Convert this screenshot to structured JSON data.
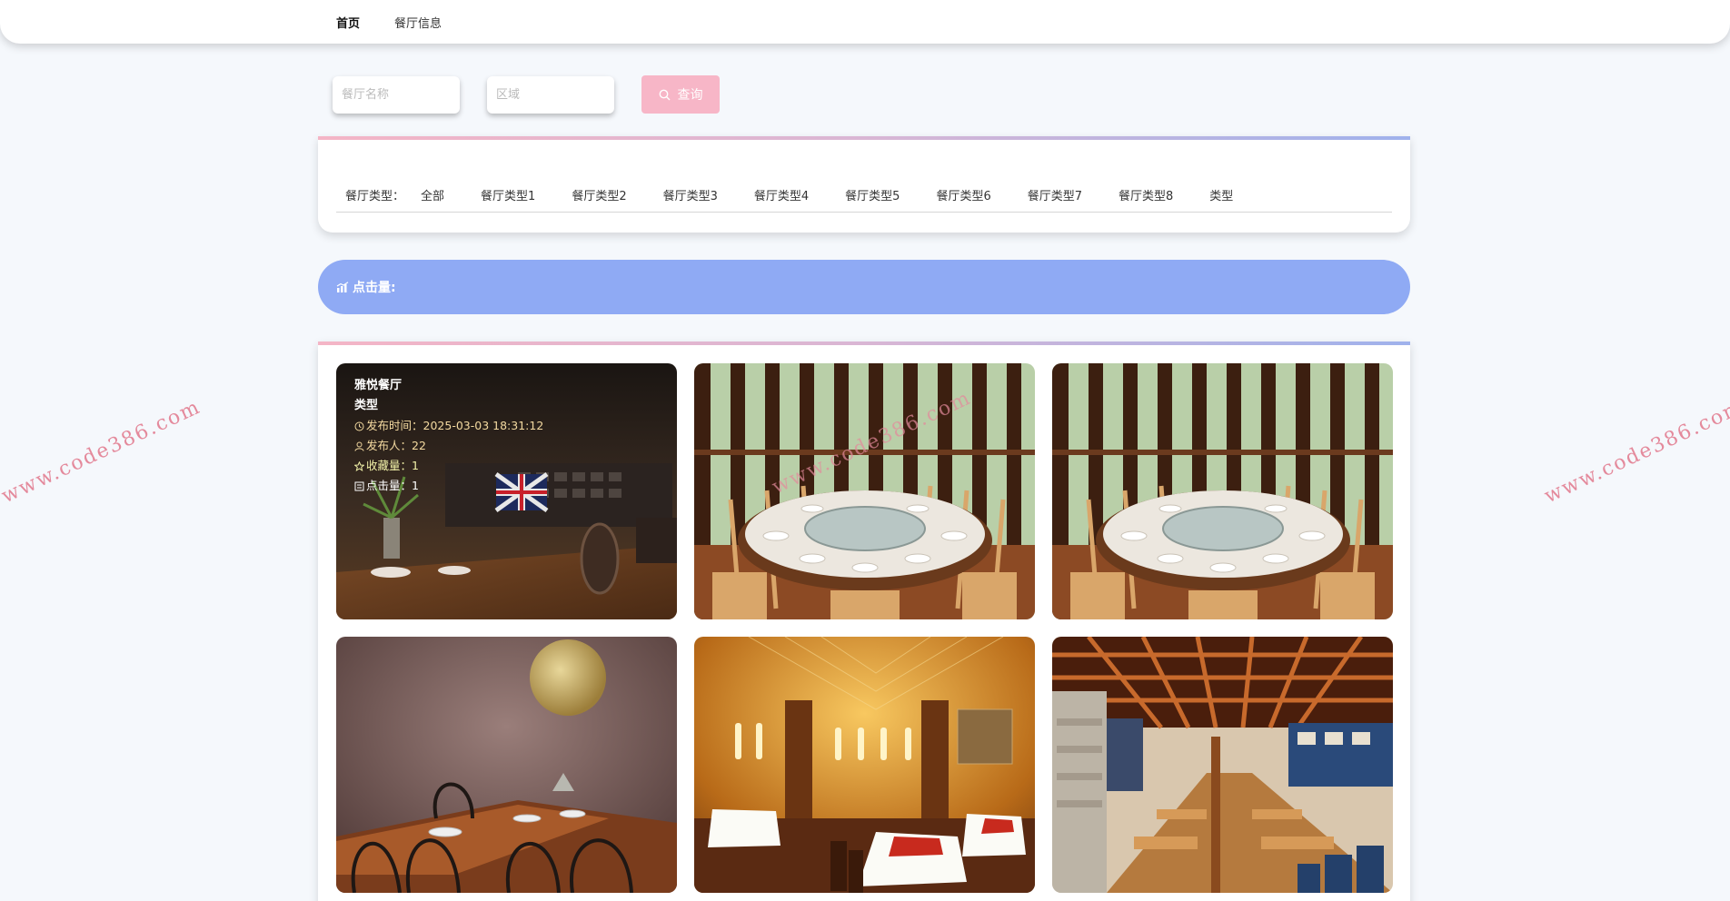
{
  "nav": {
    "items": [
      {
        "label": "首页",
        "active": true
      },
      {
        "label": "餐厅信息",
        "active": false
      }
    ]
  },
  "search": {
    "name_placeholder": "餐厅名称",
    "area_placeholder": "区域",
    "button_label": "查询"
  },
  "types": {
    "label": "餐厅类型：",
    "items": [
      "全部",
      "餐厅类型1",
      "餐厅类型2",
      "餐厅类型3",
      "餐厅类型4",
      "餐厅类型5",
      "餐厅类型6",
      "餐厅类型7",
      "餐厅类型8",
      "类型"
    ]
  },
  "banner": {
    "label": "点击量:"
  },
  "cards": [
    {
      "title": "雅悦餐厅",
      "type": "类型",
      "publish_label": "发布时间：",
      "publish_time": "2025-03-03 18:31:12",
      "author_label": "发布人：",
      "author": "22",
      "fav_label": "收藏量：",
      "fav": "1",
      "clicks_label": "点击量：",
      "clicks": "1",
      "scene": "dark-bistro"
    },
    {
      "scene": "round-table-pavilion"
    },
    {
      "scene": "round-table-pavilion"
    },
    {
      "scene": "moon-wall-dining"
    },
    {
      "scene": "golden-hall"
    },
    {
      "scene": "wooden-ceiling-hall"
    }
  ],
  "watermark": "www.code386.com",
  "colors": {
    "accent_pink": "#f7b6c7",
    "banner_blue": "#8faaf4",
    "meta_gold": "#f3d9a0"
  }
}
